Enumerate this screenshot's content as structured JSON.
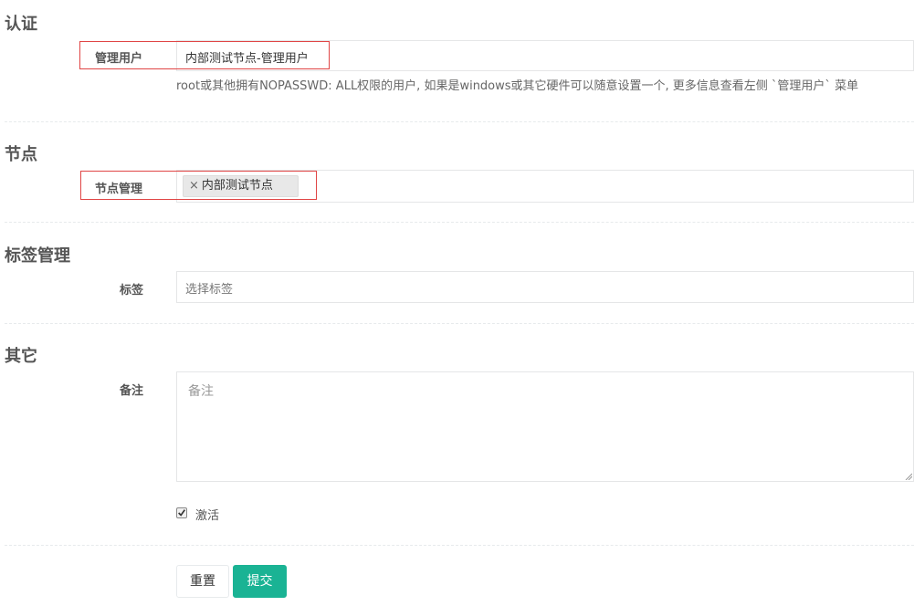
{
  "auth": {
    "section_title": "认证",
    "admin_user_label": "管理用户",
    "admin_user_value": "内部测试节点-管理用户",
    "help_text": "root或其他拥有NOPASSWD: ALL权限的用户, 如果是windows或其它硬件可以随意设置一个, 更多信息查看左侧 `管理用户` 菜单"
  },
  "nodes": {
    "section_title": "节点",
    "node_manage_label": "节点管理",
    "selected_tags": [
      {
        "remove": "×",
        "label": "内部测试节点"
      }
    ]
  },
  "labels": {
    "section_title": "标签管理",
    "label_field_label": "标签",
    "label_placeholder": "选择标签"
  },
  "other": {
    "section_title": "其它",
    "remark_label": "备注",
    "remark_placeholder": "备注",
    "active_label": "激活",
    "active_checked": true
  },
  "actions": {
    "reset_label": "重置",
    "submit_label": "提交"
  },
  "colors": {
    "accent": "#1ab394",
    "highlight": "#e04545"
  }
}
